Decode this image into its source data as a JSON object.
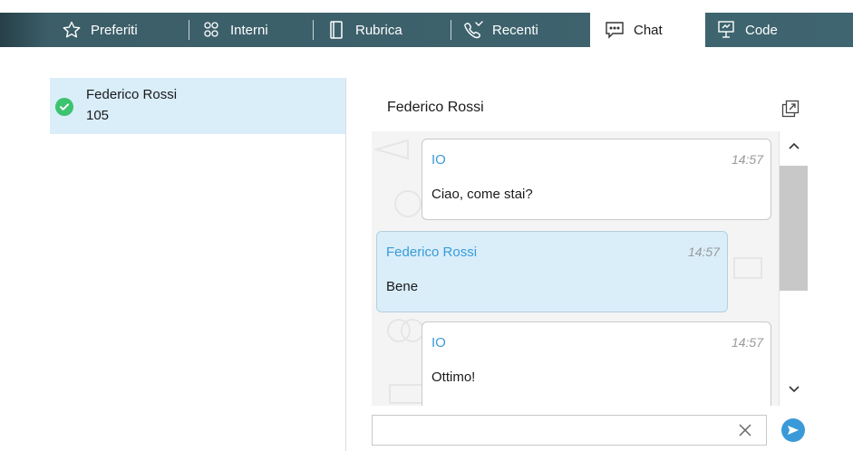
{
  "tabs": [
    {
      "label": "Preferiti",
      "icon": "star-icon"
    },
    {
      "label": "Interni",
      "icon": "users-icon"
    },
    {
      "label": "Rubrica",
      "icon": "phonebook-icon"
    },
    {
      "label": "Recenti",
      "icon": "recent-calls-icon"
    },
    {
      "label": "Chat",
      "icon": "chat-icon",
      "active": true
    },
    {
      "label": "Code",
      "icon": "queue-icon"
    }
  ],
  "contacts": [
    {
      "name": "Federico Rossi",
      "extension": "105",
      "status": "online",
      "status_color": "#3cc36f"
    }
  ],
  "chat": {
    "title": "Federico Rossi",
    "messages": [
      {
        "sender": "IO",
        "time": "14:57",
        "text": "Ciao, come stai?",
        "direction": "outgoing"
      },
      {
        "sender": "Federico Rossi",
        "time": "14:57",
        "text": "Bene",
        "direction": "incoming"
      },
      {
        "sender": "IO",
        "time": "14:57",
        "text": "Ottimo!",
        "direction": "outgoing"
      }
    ],
    "input_value": ""
  },
  "colors": {
    "tabbar": "#3f6570",
    "selected_bg": "#d9eef9",
    "accent": "#3a9ad9",
    "online": "#3cc36f"
  }
}
